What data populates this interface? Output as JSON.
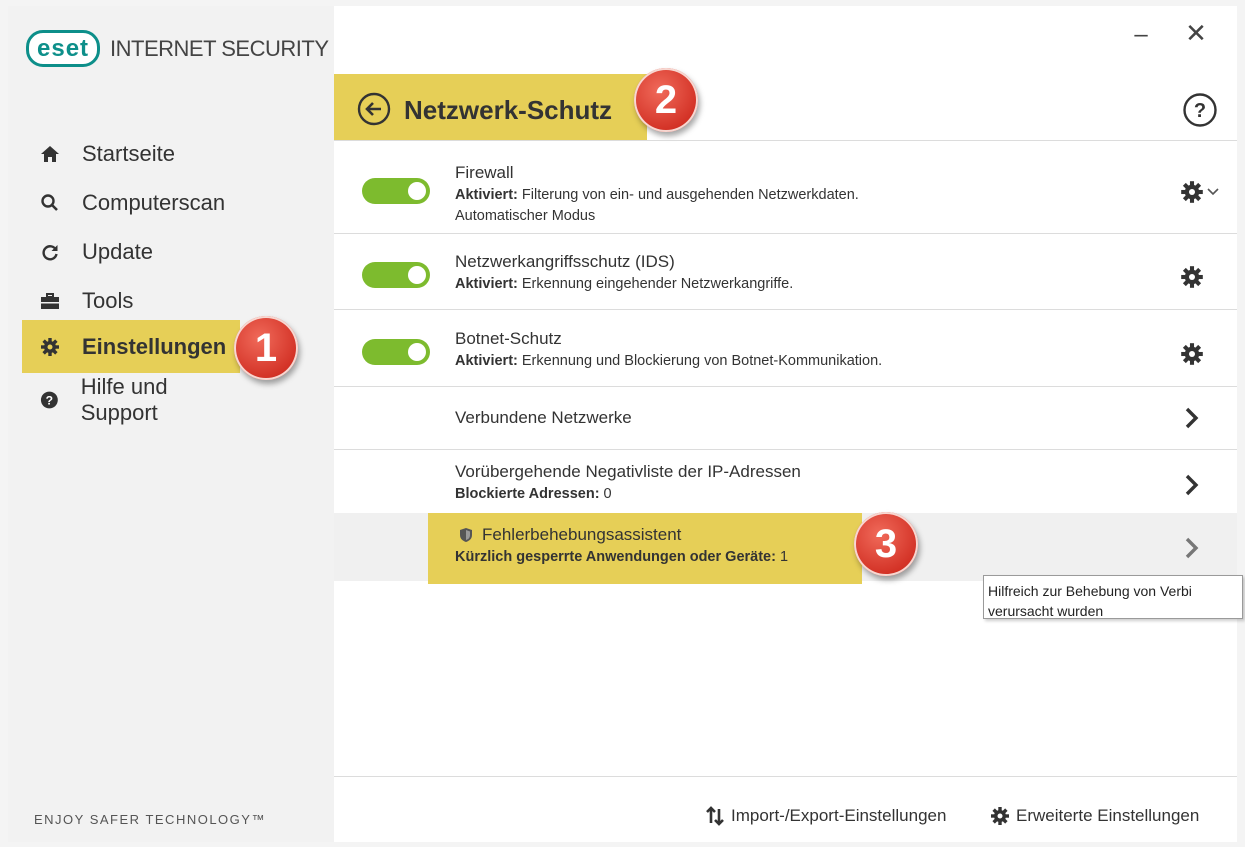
{
  "app": {
    "logo_text": "eset",
    "product_name": "INTERNET SECURITY",
    "tagline": "ENJOY SAFER TECHNOLOGY™",
    "brand_color": "#0d8f8a",
    "highlight_color": "#e6cf57",
    "toggle_color": "#7dbb2e"
  },
  "window_controls": {
    "minimize": "–",
    "close": "✕"
  },
  "sidebar": {
    "items": [
      {
        "label": "Startseite",
        "icon": "home-icon",
        "active": false
      },
      {
        "label": "Computerscan",
        "icon": "search-icon",
        "active": false
      },
      {
        "label": "Update",
        "icon": "refresh-icon",
        "active": false
      },
      {
        "label": "Tools",
        "icon": "briefcase-icon",
        "active": false
      },
      {
        "label": "Einstellungen",
        "icon": "gear-icon",
        "active": true
      },
      {
        "label": "Hilfe und Support",
        "icon": "help-circle-icon",
        "active": false
      }
    ]
  },
  "annotations": {
    "badge1": "1",
    "badge2": "2",
    "badge3": "3"
  },
  "header": {
    "title": "Netzwerk-Schutz"
  },
  "rows": {
    "firewall": {
      "title": "Firewall",
      "status": "Aktiviert:",
      "description": " Filterung von ein- und ausgehenden Netzwerkdaten.",
      "mode": "Automatischer Modus",
      "enabled": true
    },
    "ids": {
      "title": "Netzwerkangriffsschutz (IDS)",
      "status": "Aktiviert:",
      "description": " Erkennung eingehender Netzwerkangriffe.",
      "enabled": true
    },
    "botnet": {
      "title": "Botnet-Schutz",
      "status": "Aktiviert:",
      "description": " Erkennung und Blockierung von Botnet-Kommunikation.",
      "enabled": true
    },
    "networks": {
      "title": "Verbundene Netzwerke"
    },
    "blacklist": {
      "title": "Vorübergehende Negativliste der IP-Adressen",
      "label": "Blockierte Adressen:",
      "value": " 0"
    },
    "troubleshoot": {
      "title": "Fehlerbehebungsassistent",
      "label": "Kürzlich gesperrte Anwendungen oder Geräte:",
      "value": " 1"
    }
  },
  "tooltip": {
    "line1": "Hilfreich zur Behebung von Verbi",
    "line2": "verursacht wurden"
  },
  "footer": {
    "import_export": "Import-/Export-Einstellungen",
    "advanced": "Erweiterte Einstellungen"
  }
}
